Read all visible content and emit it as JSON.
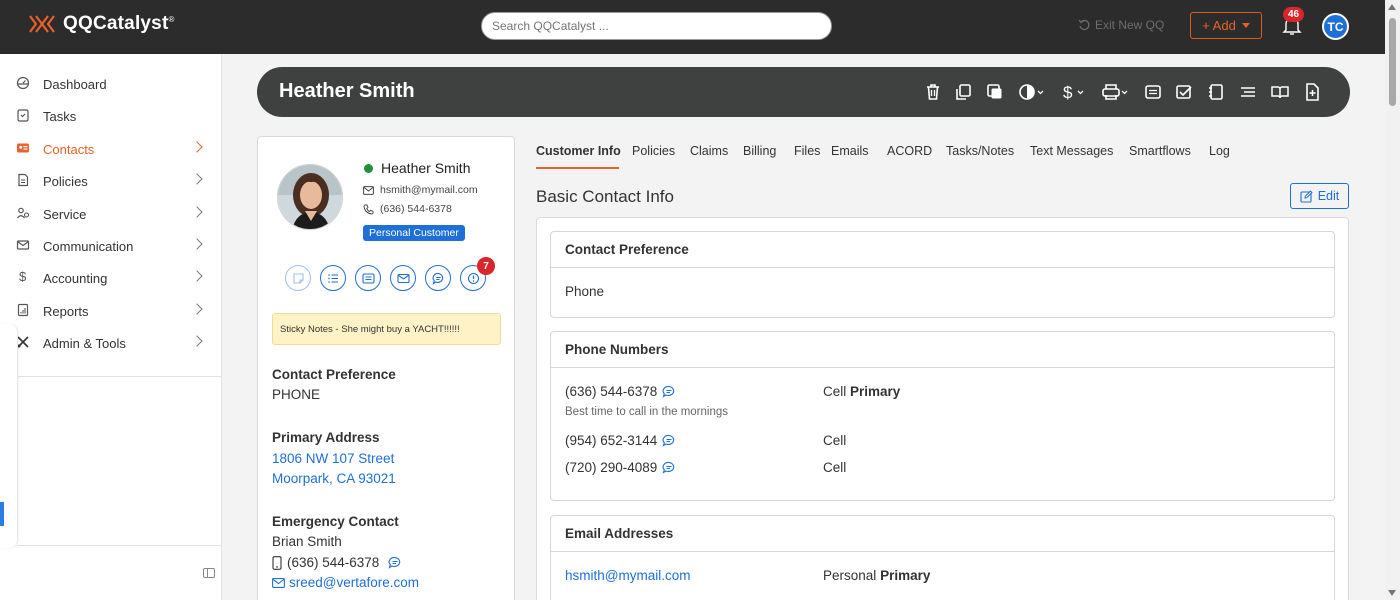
{
  "topbar": {
    "app_name": "QQCatalyst",
    "app_mark": "®",
    "search_placeholder": "Search QQCatalyst ...",
    "exit_label": "Exit New QQ",
    "add_label": "+ Add",
    "notification_count": "46",
    "user_initials": "TC"
  },
  "sidebar": {
    "items": [
      {
        "label": "Dashboard",
        "icon": "dashboard-icon"
      },
      {
        "label": "Tasks",
        "icon": "tasks-icon"
      },
      {
        "label": "Contacts",
        "icon": "contacts-icon",
        "active": true
      },
      {
        "label": "Policies",
        "icon": "policies-icon"
      },
      {
        "label": "Service",
        "icon": "service-icon"
      },
      {
        "label": "Communication",
        "icon": "communication-icon"
      },
      {
        "label": "Accounting",
        "icon": "accounting-icon"
      },
      {
        "label": "Reports",
        "icon": "reports-icon"
      },
      {
        "label": "Admin & Tools",
        "icon": "admin-tools-icon"
      }
    ]
  },
  "header": {
    "contact_name": "Heather Smith",
    "tools": [
      "delete-icon",
      "copy-icon",
      "merge-icon",
      "contrast-icon",
      "dollar-icon",
      "print-icon",
      "message-icon",
      "checkbox-icon",
      "notebook-icon",
      "list-icon",
      "book-icon",
      "add-file-icon"
    ]
  },
  "contact_card": {
    "name": "Heather Smith",
    "email": "hsmith@mymail.com",
    "phone": "(636) 544-6378",
    "type_badge": "Personal Customer",
    "alert_count": "7",
    "sticky_note": "Sticky Notes - She might buy a YACHT!!!!!!",
    "contact_pref_label": "Contact Preference",
    "contact_pref_value": "PHONE",
    "address_label": "Primary Address",
    "address_line1": "1806 NW 107 Street",
    "address_line2": "Moorpark, CA 93021",
    "emergency_label": "Emergency Contact",
    "emergency_name": "Brian Smith",
    "emergency_phone": "(636) 544-6378",
    "emergency_email": "sreed@vertafore.com"
  },
  "tabs": [
    "Customer Info",
    "Policies",
    "Claims",
    "Billing",
    "Files",
    "Emails",
    "ACORD",
    "Tasks/Notes",
    "Text Messages",
    "Smartflows",
    "Log"
  ],
  "main": {
    "section_title": "Basic Contact Info",
    "edit_label": "Edit",
    "contact_pref_title": "Contact Preference",
    "contact_pref_value": "Phone",
    "phones_title": "Phone Numbers",
    "phones": [
      {
        "number": "(636) 544-6378",
        "type": "Cell",
        "primary": "Primary",
        "note": "Best time to call in the mornings"
      },
      {
        "number": "(954) 652-3144",
        "type": "Cell",
        "primary": "",
        "note": ""
      },
      {
        "number": "(720) 290-4089",
        "type": "Cell",
        "primary": "",
        "note": ""
      }
    ],
    "emails_title": "Email Addresses",
    "emails": [
      {
        "address": "hsmith@mymail.com",
        "type": "Personal",
        "primary": "Primary"
      }
    ]
  },
  "colors": {
    "accent": "#e8622a",
    "link": "#1f6fd8",
    "topbar": "#2c2c2c",
    "header": "#3f4040",
    "badge_red": "#d8262b",
    "status_green": "#1e8f3a",
    "sticky": "#fff2c6"
  }
}
